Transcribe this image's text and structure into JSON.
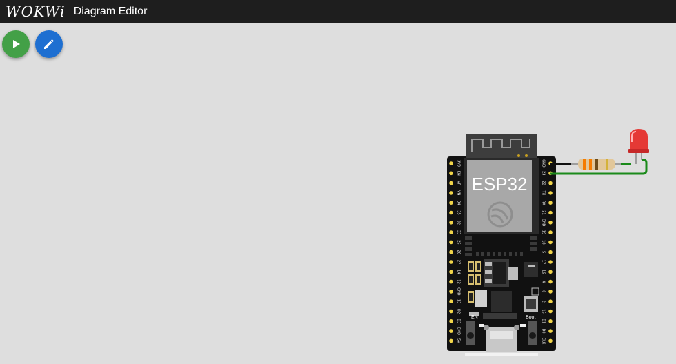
{
  "header": {
    "logo": "WOKWi",
    "title": "Diagram Editor"
  },
  "toolbar": {
    "play_icon": "play-icon",
    "edit_icon": "pencil-icon",
    "play_color": "#43a047",
    "edit_color": "#1e6fd1"
  },
  "board": {
    "chip_label": "ESP32",
    "en_label": "EN",
    "boot_label": "Boot",
    "left_pins": [
      "3V3",
      "EN",
      "VP",
      "VN",
      "34",
      "35",
      "32",
      "33",
      "25",
      "26",
      "27",
      "14",
      "12",
      "GND",
      "13",
      "D2",
      "D3",
      "CMD",
      "5V"
    ],
    "right_pins": [
      "GND",
      "23",
      "22",
      "TX",
      "RX",
      "21",
      "GND",
      "19",
      "18",
      "5",
      "17",
      "16",
      "4",
      "0",
      "2",
      "15",
      "D1",
      "D0",
      "CLK"
    ]
  },
  "components": {
    "resistor": "resistor",
    "led_color": "#e53935"
  }
}
